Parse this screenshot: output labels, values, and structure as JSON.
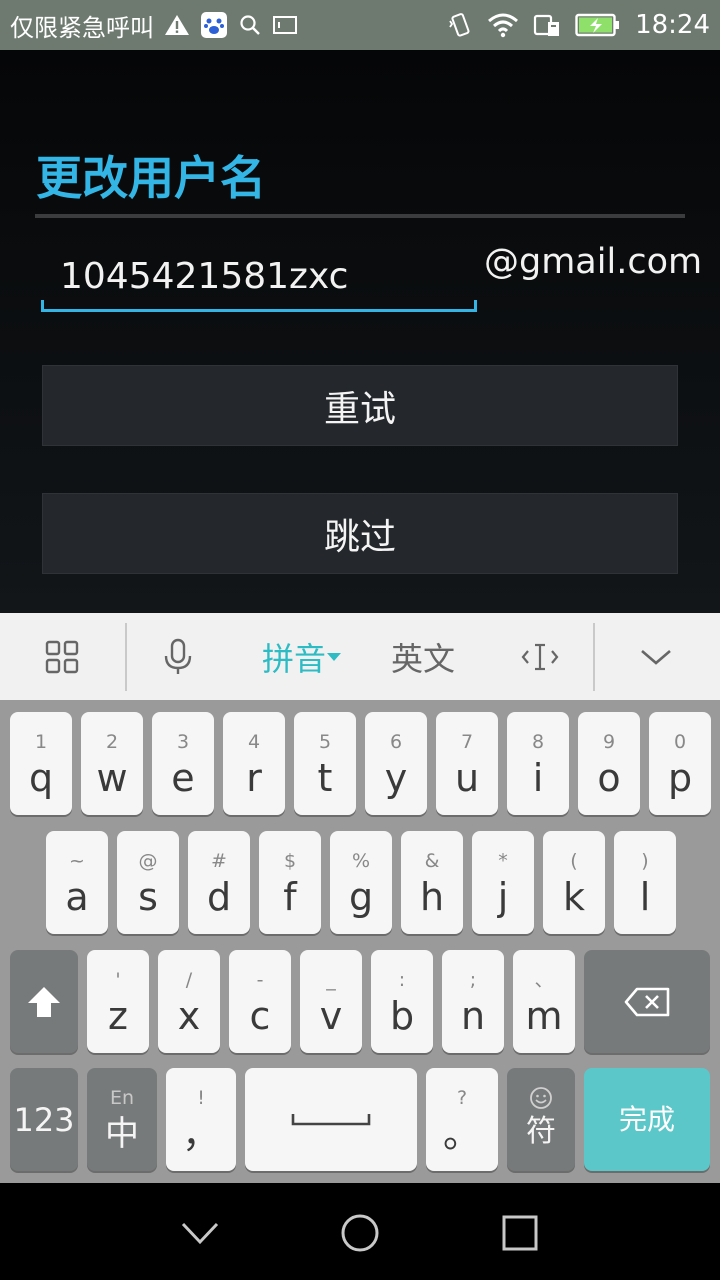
{
  "status_bar": {
    "carrier_text": "仅限紧急呼叫",
    "time": "18:24",
    "icons": [
      "warning-icon",
      "baidu-icon",
      "search-icon",
      "terminal-icon",
      "vibrate-icon",
      "wifi-icon",
      "sim-icon",
      "battery-charging-icon"
    ]
  },
  "dialog": {
    "title": "更改用户名",
    "username_value": "1045421581zxc",
    "domain_suffix": "@gmail.com",
    "retry_label": "重试",
    "skip_label": "跳过"
  },
  "ime_toolbar": {
    "pinyin_label": "拼音",
    "english_label": "英文",
    "icons": [
      "grid-menu-icon",
      "microphone-icon",
      "cursor-icon",
      "collapse-keyboard-icon"
    ]
  },
  "keyboard": {
    "row1": [
      {
        "hint": "1",
        "key": "q"
      },
      {
        "hint": "2",
        "key": "w"
      },
      {
        "hint": "3",
        "key": "e"
      },
      {
        "hint": "4",
        "key": "r"
      },
      {
        "hint": "5",
        "key": "t"
      },
      {
        "hint": "6",
        "key": "y"
      },
      {
        "hint": "7",
        "key": "u"
      },
      {
        "hint": "8",
        "key": "i"
      },
      {
        "hint": "9",
        "key": "o"
      },
      {
        "hint": "0",
        "key": "p"
      }
    ],
    "row2": [
      {
        "hint": "~",
        "key": "a"
      },
      {
        "hint": "@",
        "key": "s"
      },
      {
        "hint": "#",
        "key": "d"
      },
      {
        "hint": "$",
        "key": "f"
      },
      {
        "hint": "%",
        "key": "g"
      },
      {
        "hint": "&",
        "key": "h"
      },
      {
        "hint": "*",
        "key": "j"
      },
      {
        "hint": "(",
        "key": "k"
      },
      {
        "hint": ")",
        "key": "l"
      }
    ],
    "row3": [
      {
        "hint": "'",
        "key": "z"
      },
      {
        "hint": "/",
        "key": "x"
      },
      {
        "hint": "-",
        "key": "c"
      },
      {
        "hint": "_",
        "key": "v"
      },
      {
        "hint": ":",
        "key": "b"
      },
      {
        "hint": ";",
        "key": "n"
      },
      {
        "hint": "、",
        "key": "m"
      }
    ],
    "numbers_label": "123",
    "lang_hint": "En",
    "lang_label": "中",
    "comma_hint": "!",
    "comma_label": "，",
    "period_hint": "?",
    "period_label": "。",
    "symbol_label": "符",
    "done_label": "完成"
  },
  "nav_bar": {
    "icons": [
      "back-icon",
      "home-icon",
      "recents-icon"
    ]
  }
}
